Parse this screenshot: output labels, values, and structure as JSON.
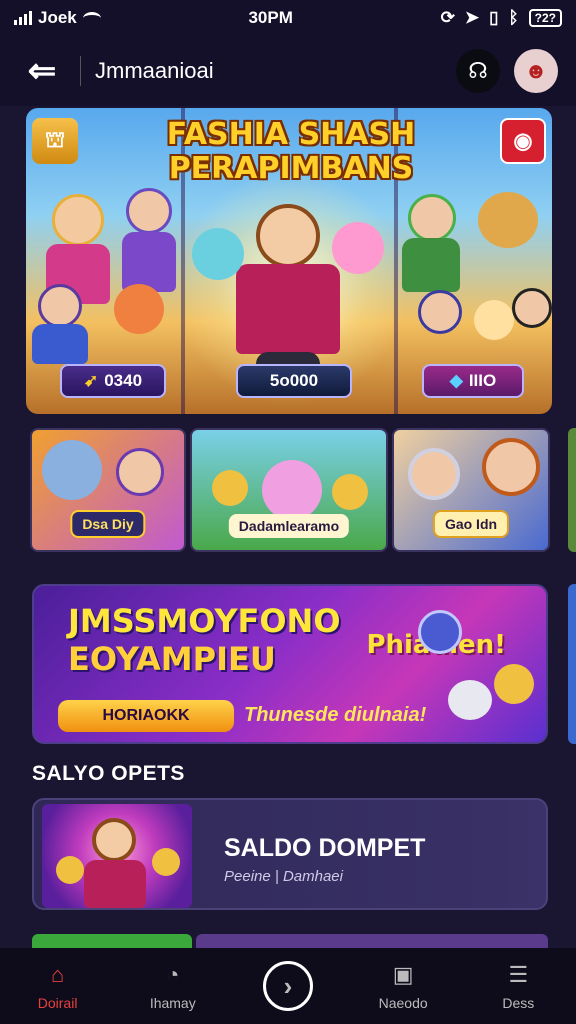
{
  "status_bar": {
    "carrier": "Joek",
    "time": "30PM",
    "battery": "?2?"
  },
  "header": {
    "title": "Jmmaanioai"
  },
  "hero": {
    "title_line1": "FASHIA SHASH",
    "title_line2": "PERAPIMBANS",
    "left_pill": "0340",
    "center_pill": "5o000",
    "right_pill": "IIIO"
  },
  "tiles": [
    {
      "label": "Dsa Diy"
    },
    {
      "label": "Dadamlearamo"
    },
    {
      "label": "Gao Idn"
    }
  ],
  "promo": {
    "title_line1": "JMSSMOYFONO",
    "title_line2": "EOYAMPIEU",
    "side_text": "Phiadien!",
    "button": "HORIAOKK",
    "tagline": "Thunesde diulnaia!"
  },
  "section": {
    "title": "SALYO OPETS"
  },
  "wallet": {
    "title": "SALDO DOMPET",
    "subtitle": "Peeine | Damhaei"
  },
  "nav": [
    {
      "label": "Doirail",
      "icon": "home-icon"
    },
    {
      "label": "Ihamay",
      "icon": "clock-icon"
    },
    {
      "label": "",
      "icon": "arrow-right-icon"
    },
    {
      "label": "Naeodo",
      "icon": "bag-icon"
    },
    {
      "label": "Dess",
      "icon": "grid-icon"
    }
  ],
  "colors": {
    "background": "#1a1530",
    "accent": "#e84040",
    "gold": "#ffd02a"
  }
}
